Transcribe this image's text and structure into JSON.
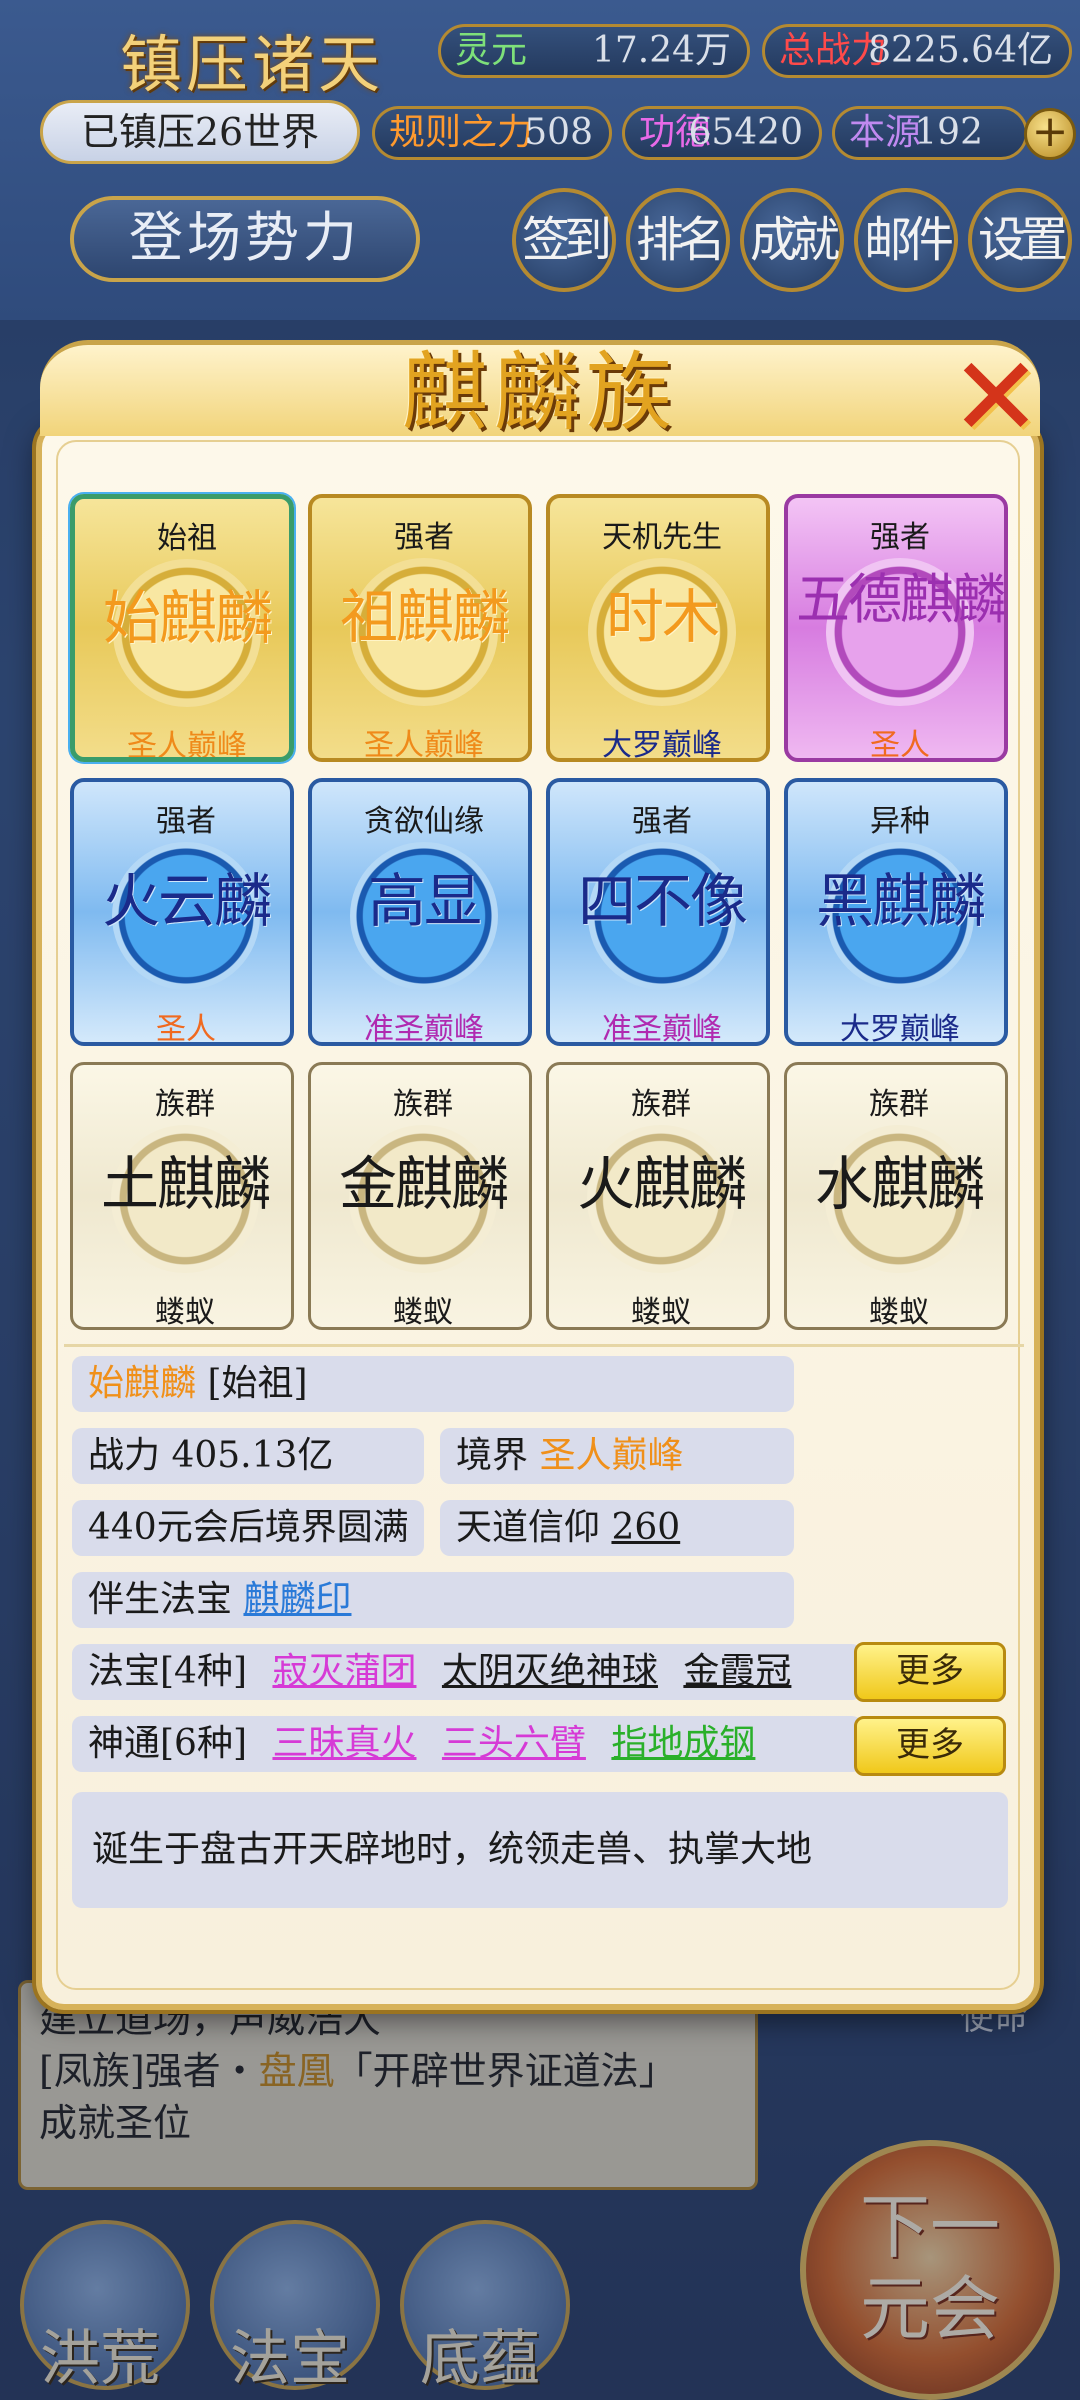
{
  "hud": {
    "title": "镇压诸天",
    "subtitle": "已镇压26世界",
    "stats": {
      "lingyuan": {
        "label": "灵元",
        "value": "17.24万"
      },
      "power": {
        "label": "总战力",
        "value": "8225.64亿"
      },
      "rule": {
        "label": "规则之力",
        "value": "508"
      },
      "merit": {
        "label": "功德",
        "value": "65420"
      },
      "origin": {
        "label": "本源",
        "value": "192"
      }
    },
    "plus": "+",
    "scene_button": "登场势力",
    "buttons": {
      "signin": "签到",
      "rank": "排名",
      "achieve": "成就",
      "mail": "邮件",
      "settings": "设置"
    }
  },
  "popup": {
    "title": "麒麟族",
    "close": "✕",
    "cards": [
      {
        "role": "始祖",
        "name": "始麒麟",
        "rank": "圣人巅峰"
      },
      {
        "role": "强者",
        "name": "祖麒麟",
        "rank": "圣人巅峰"
      },
      {
        "role": "天机先生",
        "name": "时木",
        "rank": "大罗巅峰"
      },
      {
        "role": "强者",
        "name": "五德麒麟",
        "rank": "圣人"
      },
      {
        "role": "强者",
        "name": "火云麟",
        "rank": "圣人"
      },
      {
        "role": "贪欲仙缘",
        "name": "高显",
        "rank": "准圣巅峰"
      },
      {
        "role": "强者",
        "name": "四不像",
        "rank": "准圣巅峰"
      },
      {
        "role": "异种",
        "name": "黑麒麟",
        "rank": "大罗巅峰"
      },
      {
        "role": "族群",
        "name": "土麒麟",
        "rank": "蝼蚁"
      },
      {
        "role": "族群",
        "name": "金麒麟",
        "rank": "蝼蚁"
      },
      {
        "role": "族群",
        "name": "火麒麟",
        "rank": "蝼蚁"
      },
      {
        "role": "族群",
        "name": "水麒麟",
        "rank": "蝼蚁"
      }
    ],
    "detail": {
      "name": "始麒麟",
      "tag": "[始祖]",
      "power_label": "战力",
      "power_value": "405.13亿",
      "realm_label": "境界",
      "realm_value": "圣人巅峰",
      "complete": "440元会后境界圆满",
      "faith_label": "天道信仰",
      "faith_value": "260",
      "companion_label": "伴生法宝",
      "companion_value": "麒麟印",
      "treasure_label": "法宝[4种]",
      "treasures": [
        "寂灭蒲团",
        "太阴灭绝神球",
        "金霞冠"
      ],
      "skill_label": "神通[6种]",
      "skills": [
        "三昧真火",
        "三头六臂",
        "指地成钢"
      ],
      "more": "更多",
      "description": "诞生于盘古开天辟地时，统领走兽、执掌大地"
    }
  },
  "background": {
    "line1": "建立道场，声威浩大",
    "line2_pre": "[凤族]强者・",
    "line2_name": "盘凰",
    "line2_post": "「开辟世界证道法」",
    "line3": "成就圣位",
    "mission": "使命",
    "bottom": [
      "洪荒",
      "法宝",
      "底蕴"
    ],
    "next": "下一元会"
  }
}
